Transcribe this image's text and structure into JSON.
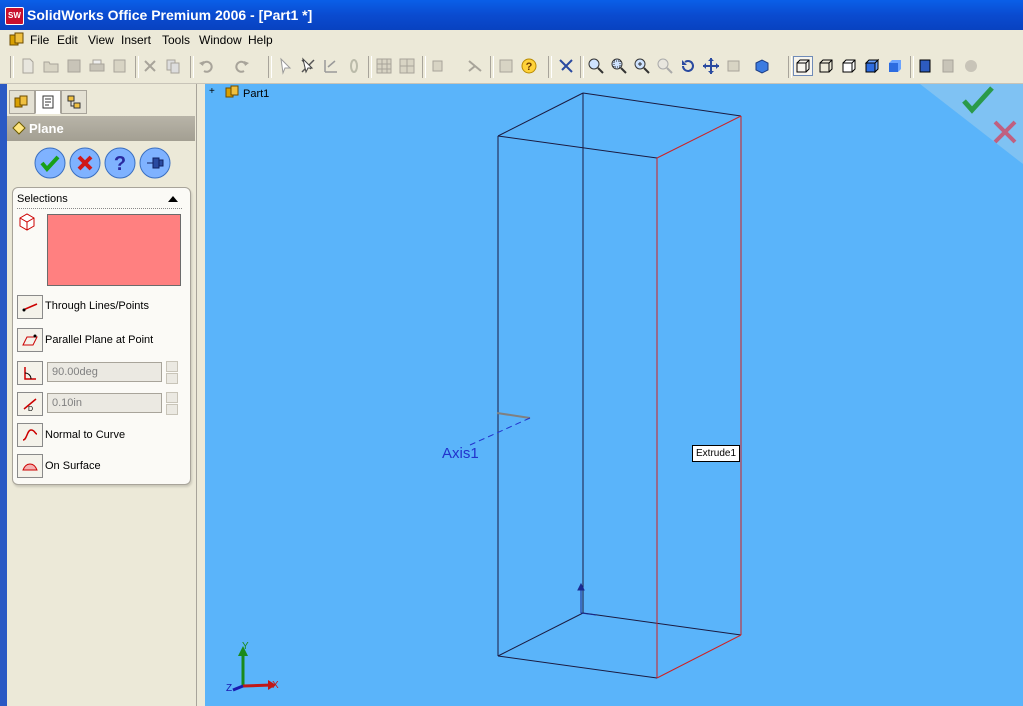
{
  "window": {
    "title": "SolidWorks Office Premium 2006 - [Part1 *]",
    "app_icon_text": "SW"
  },
  "menu": [
    "File",
    "Edit",
    "View",
    "Insert",
    "Tools",
    "Window",
    "Help"
  ],
  "toolbar": {
    "icons": [
      "new-icon",
      "open-icon",
      "save-icon",
      "print-icon",
      "print-preview-icon",
      "cut-icon",
      "copy-icon",
      "undo-icon",
      "redo-icon",
      "select-icon",
      "smart-dimension-icon",
      "sketch-icon",
      "spline-icon",
      "grid-icon",
      "grid2-icon",
      "view-icon",
      "rebuild-icon",
      "options-icon",
      "help-icon",
      "zoom-to-fit-icon",
      "zoom-area-icon",
      "zoom-in-out-icon",
      "zoom-selection-icon",
      "rotate-icon",
      "pan-icon",
      "view-orientation-icon",
      "standard-views-icon",
      "wireframe-icon",
      "hidden-lines-visible-icon",
      "hidden-lines-removed-icon",
      "shaded-with-edges-icon",
      "shaded-icon",
      "section-view-icon",
      "realview-icon",
      "shadows-icon"
    ]
  },
  "panel": {
    "tabs": [
      "featuremanager-tab",
      "propertymanager-tab",
      "configurationmanager-tab"
    ],
    "header": "Plane",
    "selections_title": "Selections",
    "options": {
      "through_lines": "Through Lines/Points",
      "parallel_plane": "Parallel Plane at Point",
      "angle_value": "90.00deg",
      "offset_value": "0.10in",
      "normal_to_curve": "Normal to Curve",
      "on_surface": "On Surface"
    }
  },
  "tree": {
    "root": "Part1",
    "expand": "+"
  },
  "viewport": {
    "tooltip": "Extrude1",
    "axis_label": "Axis1",
    "triad": {
      "y": "Y",
      "x": "X",
      "z": "Z"
    }
  }
}
